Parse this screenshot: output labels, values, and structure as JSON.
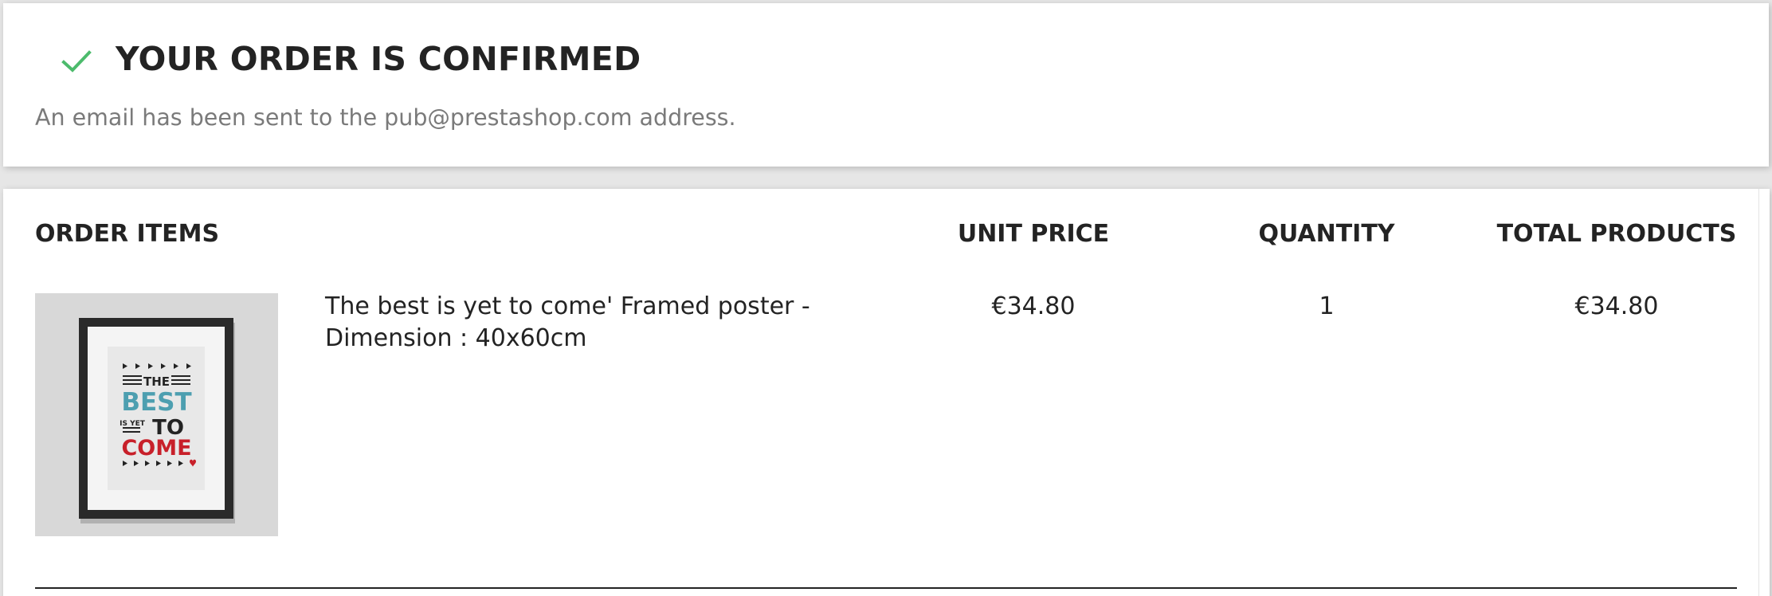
{
  "confirmation": {
    "title": "YOUR ORDER IS CONFIRMED",
    "email_message": "An email has been sent to the pub@prestashop.com address.",
    "check_icon": "check-icon",
    "check_color": "#4cbb6c"
  },
  "order_items": {
    "headers": {
      "items": "ORDER ITEMS",
      "unit_price": "UNIT PRICE",
      "quantity": "QUANTITY",
      "total": "TOTAL PRODUCTS"
    },
    "rows": [
      {
        "name": "The best is yet to come' Framed poster - Dimension : 40x60cm",
        "unit_price": "€34.80",
        "quantity": "1",
        "total": "€34.80",
        "poster": {
          "line1": "THE",
          "line2": "BEST",
          "line3": "IS YET",
          "line4": "TO",
          "line5": "COME",
          "colors": {
            "best": "#4d9fb0",
            "come": "#c8202a",
            "dark": "#232323"
          }
        }
      }
    ]
  }
}
